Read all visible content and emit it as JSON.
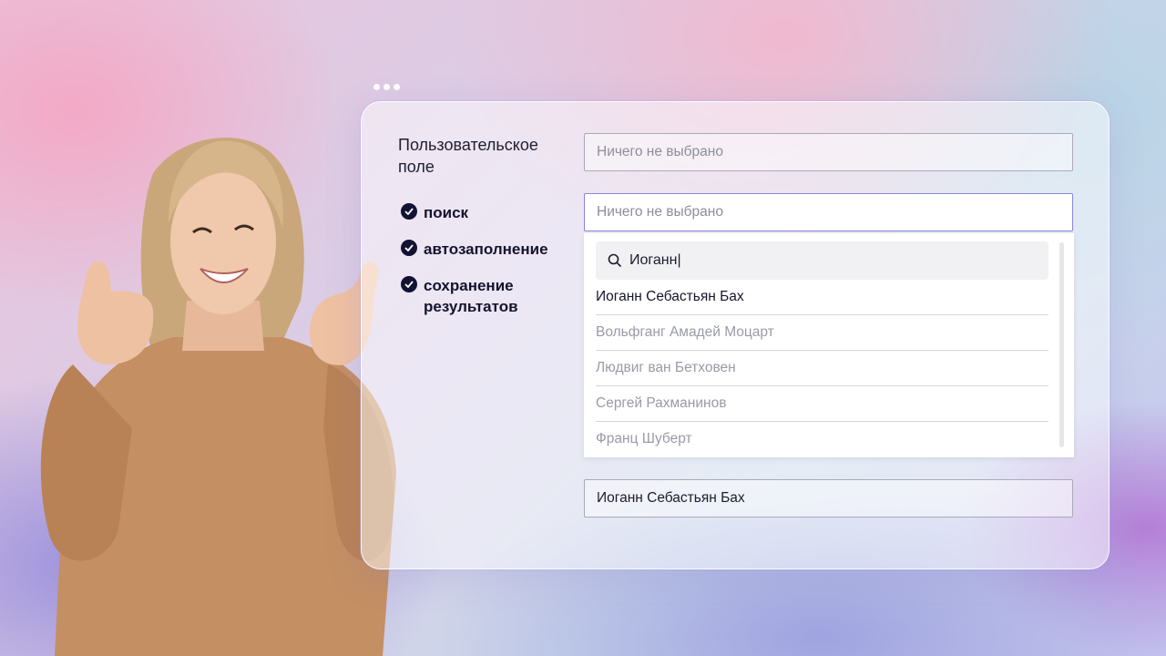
{
  "form": {
    "custom_field_label": "Пользовательское поле",
    "select_1_placeholder": "Ничего не выбрано",
    "select_2_placeholder": "Ничего не выбрано",
    "search_value": "Иоганн|",
    "options": [
      "Иоганн Себастьян Бах",
      "Вольфганг Амадей Моцарт",
      "Людвиг ван Бетховен",
      "Сергей Рахманинов",
      "Франц Шуберт"
    ],
    "selected_option": "Иоганн Себастьян Бах",
    "result_value": "Иоганн Себастьян Бах"
  },
  "features": [
    "поиск",
    "автозаполнение",
    "сохранение результатов"
  ],
  "icons": {
    "check": "check-circle-icon",
    "search": "search-icon"
  },
  "colors": {
    "check_bg": "#121234",
    "focus_border": "#8b84e0"
  }
}
